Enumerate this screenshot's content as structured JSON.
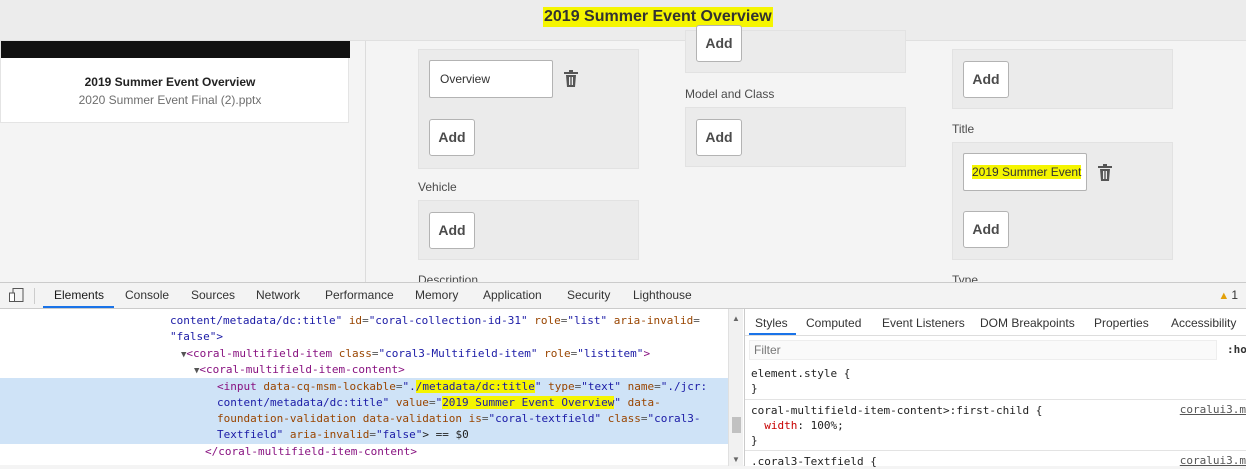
{
  "page_title": "2019 Summer Event Overview",
  "asset_card": {
    "name": "2019 Summer Event Overview",
    "file": "2020 Summer Event Final (2).pptx"
  },
  "form": {
    "add_label": "Add",
    "col1": {
      "overview_value": "Overview",
      "vehicle_label": "Vehicle",
      "description_label": "Description"
    },
    "col2": {
      "model_label": "Model and Class"
    },
    "col3": {
      "title_label": "Title",
      "title_value": "2019 Summer Event",
      "type_label": "Type"
    }
  },
  "devtools": {
    "tabs": [
      "Elements",
      "Console",
      "Sources",
      "Network",
      "Performance",
      "Memory",
      "Application",
      "Security",
      "Lighthouse"
    ],
    "active_tab": "Elements",
    "warnings_count": "1",
    "dom": {
      "line1_attr": "content/metadata/dc:title\"",
      "line1_id_attr": "id",
      "line1_id_val": "\"coral-collection-id-31\"",
      "line1_role_attr": "role",
      "line1_role_val": "\"list\"",
      "line1_aria_attr": "aria-invalid",
      "line1_aria_val": "=",
      "line2_val": "\"false\">",
      "line3_tag": "coral-multifield-item",
      "line3_class_attr": "class",
      "line3_class_val": "\"coral3-Multifield-item\"",
      "line3_role_attr": "role",
      "line3_role_val": "\"listitem\"",
      "line4_tag": "coral-multifield-item-content",
      "line5_tag": "input",
      "line5_attr": "data-cq-msm-lockable",
      "line5_val_q": "\".",
      "line5_val_hl": "/metadata/dc:title",
      "line5_type_attr": "type",
      "line5_type_val": "\"text\"",
      "line5_name_attr": "name",
      "line5_name_val": "\"./jcr:",
      "line6_a": "content/metadata/dc:title\"",
      "line6_value_attr": "value",
      "line6_value_hl": "2019 Summer Event Overview",
      "line6_tail": "data-",
      "line7_a": "foundation-validation data-validation",
      "line7_is_attr": "is",
      "line7_is_val": "\"coral-textfield\"",
      "line7_class_attr": "class",
      "line7_class_val": "\"coral3-",
      "line8_a": "Textfield\"",
      "line8_aria_attr": "aria-invalid",
      "line8_aria_val": "\"false\"",
      "line8_tail": "> == $0",
      "line9_tag": "/coral-multifield-item-content"
    },
    "styles_tabs": [
      "Styles",
      "Computed",
      "Event Listeners",
      "DOM Breakpoints",
      "Properties",
      "Accessibility"
    ],
    "filter_placeholder": "Filter",
    "hov_label": ":hov",
    "rules": {
      "r1_selector": "element.style {",
      "r1_close": "}",
      "r2_selector": "coral-multifield-item-content>:first-child {",
      "r2_prop": "width",
      "r2_value": ": 100%;",
      "r2_close": "}",
      "r2_source": "coralui3.m",
      "r3_selector": ".coral3-Textfield {",
      "r3_source": "coralui3.m"
    }
  }
}
